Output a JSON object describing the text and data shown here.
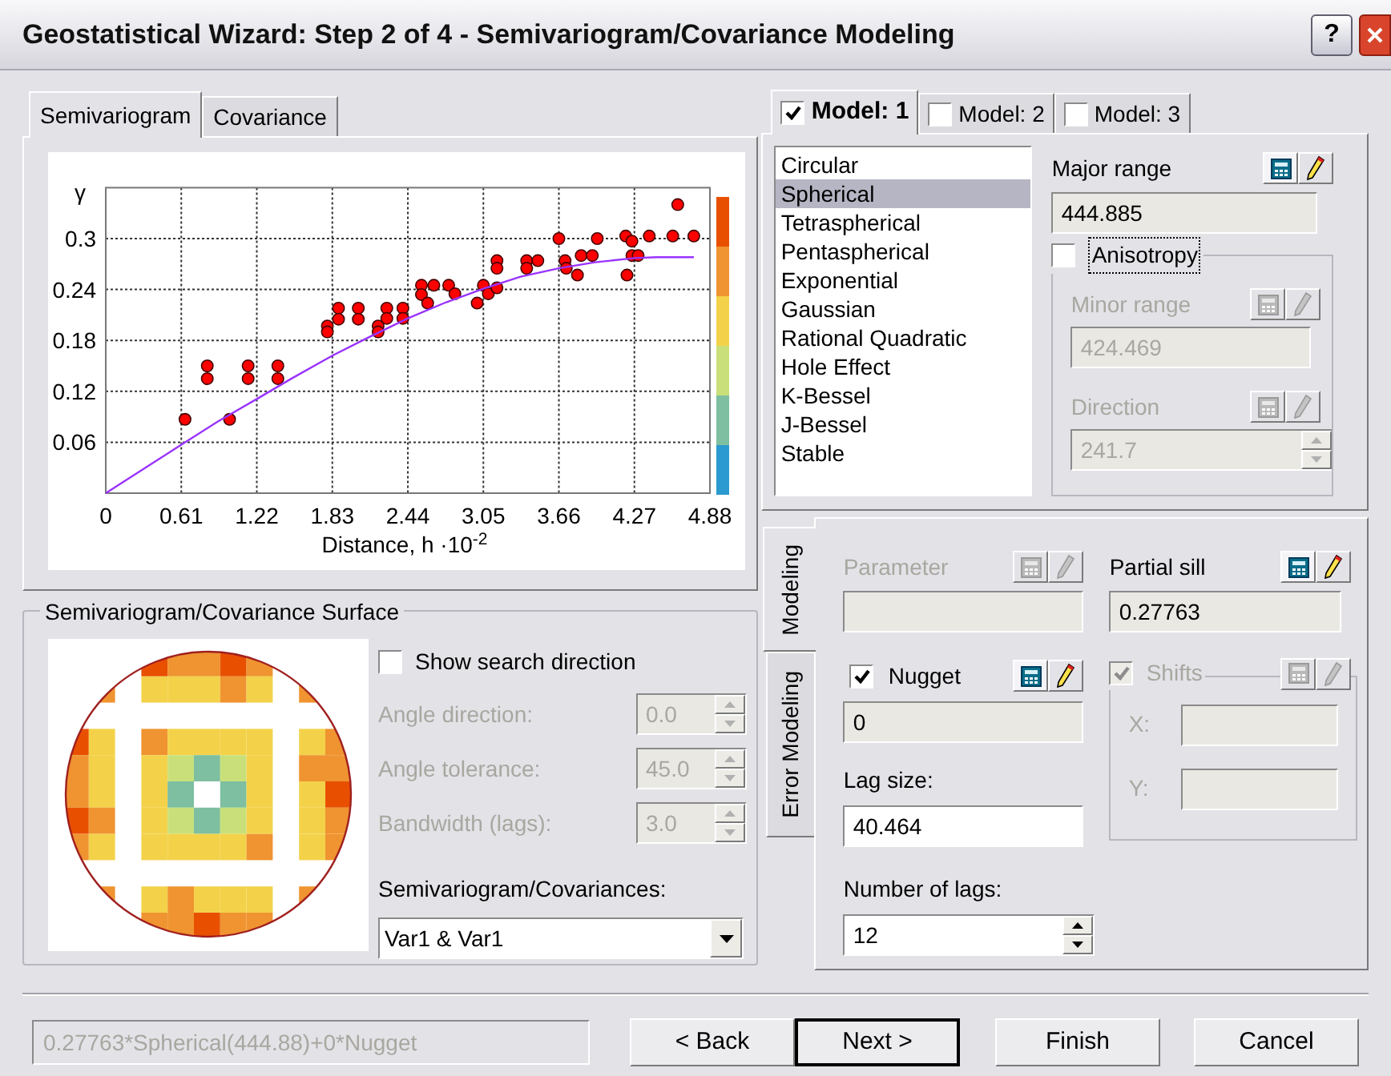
{
  "window": {
    "title": "Geostatistical Wizard: Step 2 of 4 - Semivariogram/Covariance Modeling",
    "help": "?"
  },
  "left_tabs": [
    {
      "label": "Semivariogram",
      "selected": true
    },
    {
      "label": "Covariance",
      "selected": false
    }
  ],
  "chart": {
    "chart_data": {
      "type": "scatter",
      "grid": true,
      "xlabel": "Distance, h ·10$^{-2}$",
      "ylabel": "γ",
      "xlim": [
        0,
        4.88
      ],
      "ylim": [
        0,
        0.36
      ],
      "xticks": [
        0,
        0.61,
        1.22,
        1.83,
        2.44,
        3.05,
        3.66,
        4.27,
        4.88
      ],
      "yticks": [
        0.06,
        0.12,
        0.18,
        0.24,
        0.3
      ],
      "series": [
        {
          "color": "#ff0000",
          "x": [
            0.64,
            0.82,
            0.82,
            1.0,
            1.15,
            1.15,
            1.39,
            1.39,
            1.79,
            1.79,
            1.88,
            1.88,
            2.04,
            2.04,
            2.2,
            2.2,
            2.27,
            2.27,
            2.4,
            2.4,
            2.55,
            2.55,
            2.6,
            2.65,
            2.77,
            2.82,
            3.0,
            3.05,
            3.09,
            3.16,
            3.16,
            3.16,
            3.4,
            3.4,
            3.49,
            3.66,
            3.71,
            3.72,
            3.81,
            3.84,
            3.93,
            3.97,
            4.2,
            4.21,
            4.25,
            4.25,
            4.3,
            4.39,
            4.58,
            4.62,
            4.75
          ],
          "values": [
            0.087,
            0.15,
            0.135,
            0.087,
            0.15,
            0.135,
            0.15,
            0.135,
            0.197,
            0.19,
            0.218,
            0.205,
            0.218,
            0.205,
            0.197,
            0.19,
            0.218,
            0.206,
            0.218,
            0.206,
            0.245,
            0.234,
            0.224,
            0.245,
            0.245,
            0.235,
            0.224,
            0.245,
            0.235,
            0.274,
            0.265,
            0.242,
            0.274,
            0.265,
            0.274,
            0.3,
            0.274,
            0.265,
            0.257,
            0.28,
            0.28,
            0.3,
            0.303,
            0.257,
            0.297,
            0.28,
            0.28,
            0.303,
            0.303,
            0.34,
            0.303
          ]
        },
        {
          "type": "line",
          "color": "#9933ff",
          "x": [
            0,
            0.3,
            0.61,
            0.9,
            1.22,
            1.5,
            1.83,
            2.1,
            2.44,
            2.75,
            3.05,
            3.35,
            3.66,
            3.95,
            4.27,
            4.45,
            4.75
          ],
          "values": [
            0,
            0.028,
            0.057,
            0.084,
            0.111,
            0.135,
            0.162,
            0.182,
            0.206,
            0.225,
            0.241,
            0.255,
            0.265,
            0.272,
            0.277,
            0.278,
            0.278
          ]
        }
      ]
    }
  },
  "surface": {
    "title": "Semivariogram/Covariance Surface",
    "show_search_direction": {
      "label": "Show search direction",
      "checked": false
    },
    "fields": [
      {
        "label": "Angle direction:",
        "value": "0.0",
        "disabled": true
      },
      {
        "label": "Angle tolerance:",
        "value": "45.0",
        "disabled": true
      },
      {
        "label": "Bandwidth (lags):",
        "value": "3.0",
        "disabled": true
      }
    ],
    "covariances": {
      "label": "Semivariogram/Covariances:",
      "value": "Var1 & Var1"
    }
  },
  "model_tabs": [
    {
      "label": "Model: 1",
      "checked": true,
      "selected": true
    },
    {
      "label": "Model: 2",
      "checked": false,
      "selected": false
    },
    {
      "label": "Model: 3",
      "checked": false,
      "selected": false
    }
  ],
  "models": [
    {
      "label": "Circular",
      "selected": false
    },
    {
      "label": "Spherical",
      "selected": true
    },
    {
      "label": "Tetraspherical",
      "selected": false
    },
    {
      "label": "Pentaspherical",
      "selected": false
    },
    {
      "label": "Exponential",
      "selected": false
    },
    {
      "label": "Gaussian",
      "selected": false
    },
    {
      "label": "Rational Quadratic",
      "selected": false
    },
    {
      "label": "Hole Effect",
      "selected": false
    },
    {
      "label": "K-Bessel",
      "selected": false
    },
    {
      "label": "J-Bessel",
      "selected": false
    },
    {
      "label": "Stable",
      "selected": false
    }
  ],
  "major_range": {
    "label": "Major range",
    "value": "444.885",
    "disabled": false
  },
  "anisotropy": {
    "label": "Anisotropy",
    "checked": false
  },
  "minor_range": {
    "label": "Minor range",
    "value": "424.469",
    "disabled": true
  },
  "direction": {
    "label": "Direction",
    "value": "241.7",
    "disabled": true
  },
  "side_tabs": [
    {
      "label": "Modeling",
      "selected": true
    },
    {
      "label": "Error Modeling",
      "selected": false
    }
  ],
  "parameter": {
    "label": "Parameter",
    "disabled": true
  },
  "partial_sill": {
    "label": "Partial sill",
    "value": "0.27763",
    "disabled": false
  },
  "nugget": {
    "label": "Nugget",
    "checked": true,
    "value": "0",
    "disabled": false
  },
  "shifts": {
    "label": "Shifts",
    "checked": true,
    "disabled": true,
    "fields": [
      {
        "label": "X:"
      },
      {
        "label": "Y:"
      }
    ]
  },
  "lag_size": {
    "label": "Lag size:",
    "value": "40.464"
  },
  "number_of_lags": {
    "label": "Number of lags:",
    "value": "12"
  },
  "status": {
    "formula": "0.27763*Spherical(444.88)+0*Nugget"
  },
  "buttons": [
    {
      "label": "< Back",
      "default": false
    },
    {
      "label": "Next >",
      "default": true
    },
    {
      "label": "Finish",
      "default": false
    },
    {
      "label": "Cancel",
      "default": false
    }
  ]
}
